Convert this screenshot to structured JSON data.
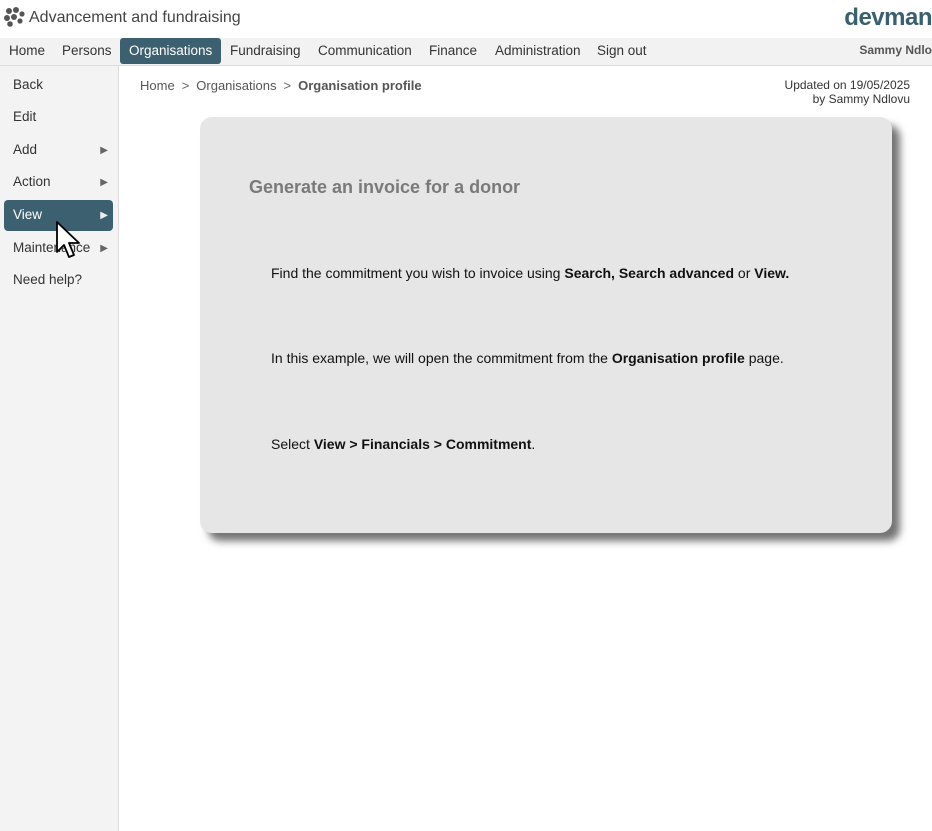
{
  "app": {
    "title": "Advancement and fundraising",
    "brand": "devman",
    "logo_icon": "paw-cluster-icon"
  },
  "nav": {
    "items": [
      {
        "label": "Home",
        "active": false
      },
      {
        "label": "Persons",
        "active": false
      },
      {
        "label": "Organisations",
        "active": true
      },
      {
        "label": "Fundraising",
        "active": false
      },
      {
        "label": "Communication",
        "active": false
      },
      {
        "label": "Finance",
        "active": false
      },
      {
        "label": "Administration",
        "active": false
      },
      {
        "label": "Sign out",
        "active": false
      }
    ],
    "user": "Sammy Ndlo"
  },
  "sidebar": {
    "items": [
      {
        "label": "Back",
        "has_submenu": false,
        "active": false
      },
      {
        "label": "Edit",
        "has_submenu": false,
        "active": false
      },
      {
        "label": "Add",
        "has_submenu": true,
        "active": false
      },
      {
        "label": "Action",
        "has_submenu": true,
        "active": false
      },
      {
        "label": "View",
        "has_submenu": true,
        "active": true
      },
      {
        "label": "Maintenance",
        "has_submenu": true,
        "active": false
      },
      {
        "label": "Need help?",
        "has_submenu": false,
        "active": false
      }
    ],
    "arrow_glyph": "▶"
  },
  "breadcrumb": {
    "items": [
      "Home",
      "Organisations",
      "Organisation profile"
    ],
    "separator": ">"
  },
  "updated": {
    "line1": "Updated on 19/05/2025",
    "line2": "by Sammy Ndlovu"
  },
  "callout": {
    "title": "Generate an invoice for a donor",
    "p1": {
      "text_a": "Find the commitment you wish to invoice using ",
      "bold_a": "Search, Search advanced",
      "text_b": " or ",
      "bold_b": "View."
    },
    "p2": {
      "text_a": "In this example, we will open the commitment from the ",
      "bold_a": "Organisation profile",
      "text_b": " page."
    },
    "p3": {
      "text_a": "Select ",
      "bold_a": "View > Financials > Commitment",
      "text_b": "."
    }
  },
  "colors": {
    "accent": "#3d6070",
    "callout_bg": "#e6e6e6",
    "sidebar_bg": "#f3f3f3"
  }
}
